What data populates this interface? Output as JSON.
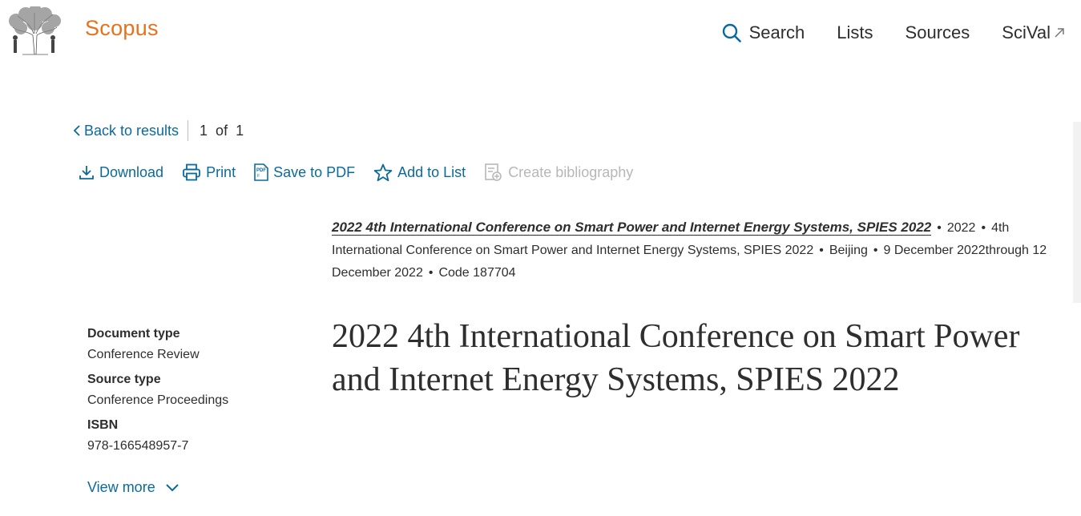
{
  "header": {
    "brand": "Scopus",
    "nav": [
      {
        "label": "Search",
        "icon": "search-icon"
      },
      {
        "label": "Lists"
      },
      {
        "label": "Sources"
      },
      {
        "label": "SciVal",
        "icon": "external-link-icon"
      }
    ]
  },
  "breadcrumb": {
    "back_label": "Back to results",
    "pager": "1 of 1"
  },
  "actions": [
    {
      "label": "Download",
      "icon": "download-icon",
      "enabled": true
    },
    {
      "label": "Print",
      "icon": "print-icon",
      "enabled": true
    },
    {
      "label": "Save to PDF",
      "icon": "pdf-icon",
      "enabled": true
    },
    {
      "label": "Add to List",
      "icon": "star-icon",
      "enabled": true
    },
    {
      "label": "Create bibliography",
      "icon": "bibliography-icon",
      "enabled": false
    }
  ],
  "source": {
    "title": "2022 4th International Conference on Smart Power and Internet Energy Systems, SPIES 2022",
    "year": "2022",
    "conference": "4th International Conference on Smart Power and Internet Energy Systems, SPIES 2022",
    "location": "Beijing",
    "dates": "9 December 2022through 12 December 2022",
    "code": "Code 187704"
  },
  "document": {
    "title": "2022 4th International Conference on Smart Power and Internet Energy Systems, SPIES 2022"
  },
  "metadata": [
    {
      "label": "Document type",
      "value": "Conference Review"
    },
    {
      "label": "Source type",
      "value": "Conference Proceedings"
    },
    {
      "label": "ISBN",
      "value": "978-166548957-7"
    }
  ],
  "view_more_label": "View more",
  "colors": {
    "brand": "#e9711c",
    "link": "#0b6a9c",
    "text": "#2e2e2e",
    "disabled": "#b7b7b7"
  }
}
